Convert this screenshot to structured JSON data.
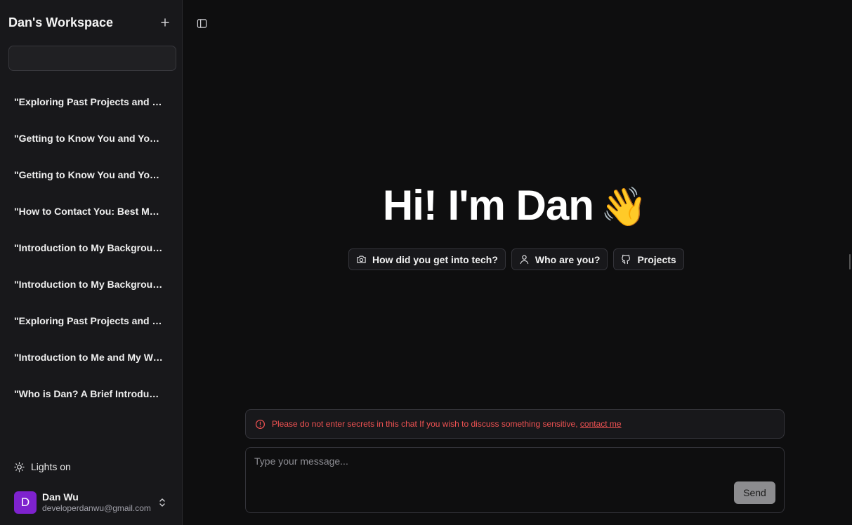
{
  "sidebar": {
    "workspace_title": "Dan's Workspace",
    "new_chat_icon": "plus-icon",
    "search_value": "",
    "conversations": [
      {
        "label": "\"Exploring Past Projects and Experiences\""
      },
      {
        "label": "\"Getting to Know You and Your Background\""
      },
      {
        "label": "\"Getting to Know You and Your Background\""
      },
      {
        "label": "\"How to Contact You: Best Methods\""
      },
      {
        "label": "\"Introduction to My Background\""
      },
      {
        "label": "\"Introduction to My Background\""
      },
      {
        "label": "\"Exploring Past Projects and Experiences\""
      },
      {
        "label": "\"Introduction to Me and My Work\""
      },
      {
        "label": "\"Who is Dan? A Brief Introduction\""
      }
    ],
    "theme_toggle": {
      "label": "Lights on",
      "icon": "sun-icon"
    },
    "user": {
      "avatar_initial": "D",
      "name": "Dan Wu",
      "email": "developerdanwu@gmail.com",
      "avatar_color": "#7e22ce"
    }
  },
  "main": {
    "sidebar_toggle_icon": "panel-left-icon",
    "greeting": "Hi! I'm Dan",
    "greeting_emoji": "👋",
    "suggestions": [
      {
        "label": "How did you get into tech?",
        "icon": "camera-icon"
      },
      {
        "label": "Who are you?",
        "icon": "user-icon"
      },
      {
        "label": "Projects",
        "icon": "github-icon"
      }
    ],
    "warning": {
      "text": "Please do not enter secrets in this chat If you wish to discuss something sensitive,",
      "link": "contact me",
      "color": "#f05252",
      "icon": "alert-circle-icon"
    },
    "composer": {
      "placeholder": "Type your message...",
      "value": "",
      "send_label": "Send"
    }
  }
}
